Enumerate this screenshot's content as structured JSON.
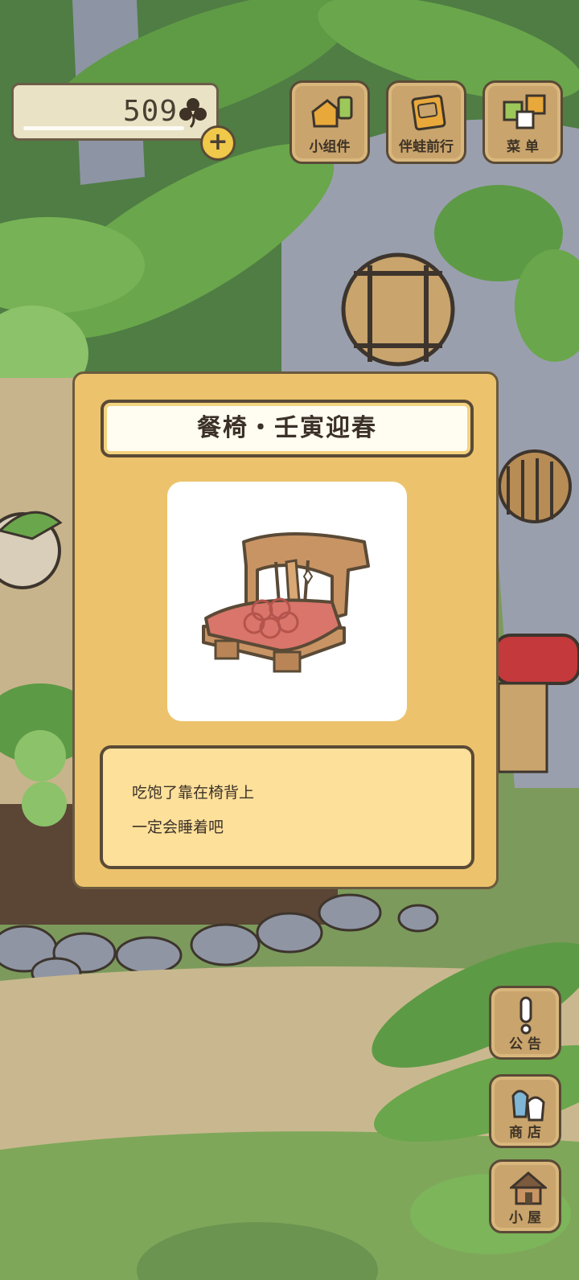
{
  "currency": {
    "clover_count": "509",
    "add_label": "+"
  },
  "top_menu": [
    {
      "label": "小组件",
      "icon": "widget-icon"
    },
    {
      "label": "伴蛙前行",
      "icon": "journal-icon"
    },
    {
      "label": "菜 单",
      "icon": "menu-cards-icon"
    }
  ],
  "side_menu": [
    {
      "label": "公 告",
      "icon": "exclamation-icon"
    },
    {
      "label": "商 店",
      "icon": "shop-bags-icon"
    },
    {
      "label": "小 屋",
      "icon": "house-icon"
    }
  ],
  "item_dialog": {
    "title": "餐椅・壬寅迎春",
    "image": "dining-chair-icon",
    "description_lines": [
      "吃饱了靠在椅背上",
      "一定会睡着吧"
    ]
  },
  "colors": {
    "dialog_bg": "#ecc36c",
    "desc_bg": "#fde09a",
    "wood": "#c9a46c",
    "outline": "#5a4a36",
    "cushion": "#d9756a"
  }
}
